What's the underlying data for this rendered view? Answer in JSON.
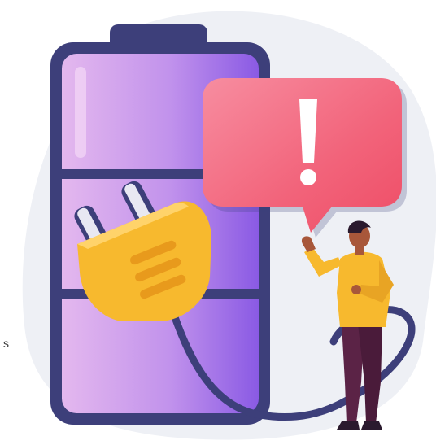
{
  "illustration": {
    "subject": "battery-low-warning",
    "colors": {
      "backdrop": "#EEF0F5",
      "battery_outline": "#3D3F7A",
      "battery_fill_light": "#E2B6EE",
      "battery_fill_dark": "#8E5EE6",
      "bubble": "#F0586F",
      "bubble_light": "#F78DA0",
      "plug": "#F7B92E",
      "plug_dark": "#E89A1C",
      "cable": "#3D3F7A",
      "shirt": "#F7B92E",
      "pants": "#5B2346",
      "skin": "#A8573A",
      "hair": "#2A1A2E"
    },
    "icons": {
      "warning": "exclamation-icon",
      "plug": "power-plug-icon",
      "battery": "battery-icon"
    }
  },
  "stray_text": "s"
}
